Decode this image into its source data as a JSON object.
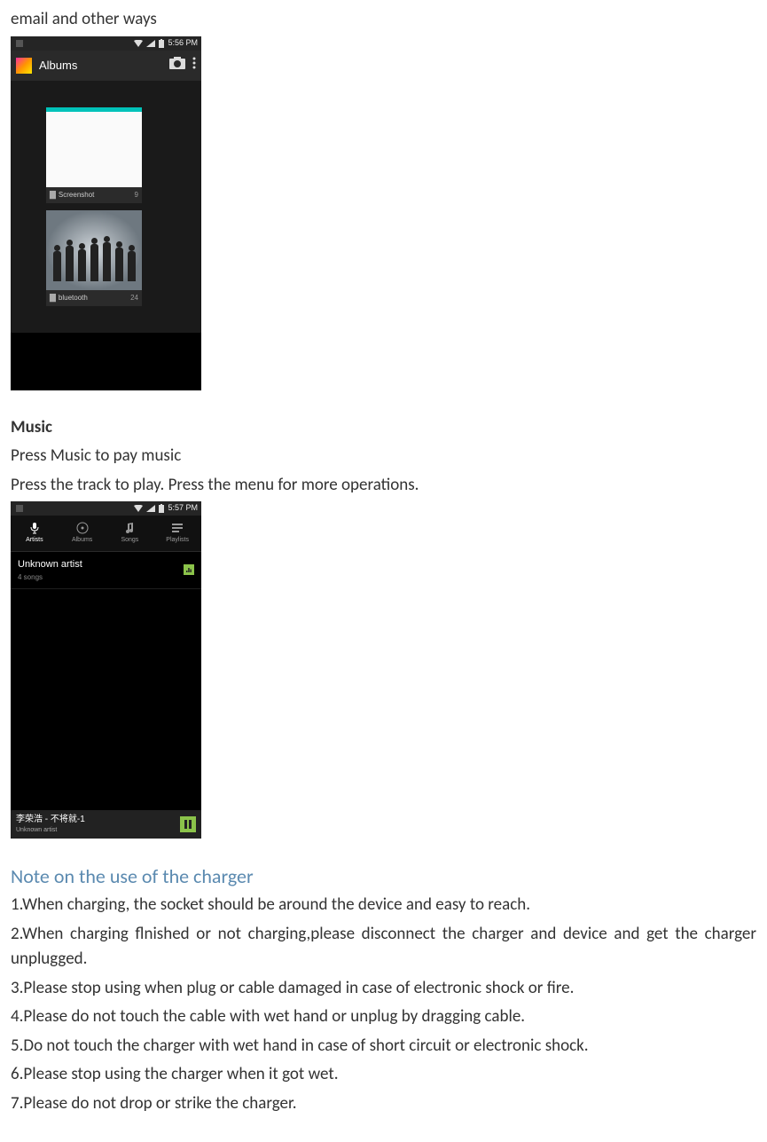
{
  "intro_line": "email and other ways",
  "albums_shot": {
    "status_time": "5:56 PM",
    "action_bar_title": "Albums",
    "albums": [
      {
        "name": "Screenshot",
        "count": "9"
      },
      {
        "name": "bluetooth",
        "count": "24"
      }
    ]
  },
  "music_section": {
    "heading": "Music",
    "line1": "Press Music to pay music",
    "line2": "Press the track to play. Press the menu for more operations."
  },
  "music_shot": {
    "status_time": "5:57 PM",
    "tabs": [
      "Artists",
      "Albums",
      "Songs",
      "Playlists"
    ],
    "artist": {
      "name": "Unknown artist",
      "sub": "4 songs"
    },
    "now_playing": {
      "title": "李荣浩 - 不将就-1",
      "artist": "Unknown artist"
    }
  },
  "charger_section": {
    "heading": "Note on the use of the charger",
    "notes": [
      "1.When charging, the socket should be around the device and easy to reach.",
      "2.When charging flnished or not charging,please disconnect the charger and device and get the charger unplugged.",
      "3.Please stop using when plug or cable damaged in case of electronic shock or fire.",
      "4.Please do not touch the cable with wet hand or unplug by dragging cable.",
      "5.Do not touch the charger with wet hand in case of short circuit or electronic shock.",
      "6.Please stop using the charger when it got wet.",
      "7.Please do not drop or strike the charger."
    ]
  }
}
